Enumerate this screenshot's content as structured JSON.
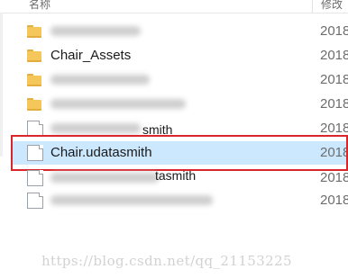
{
  "header": {
    "name_col": "名称",
    "date_col": "修改"
  },
  "rows": [
    {
      "kind": "folder",
      "name": "",
      "date": "2018",
      "blurred": true
    },
    {
      "kind": "folder",
      "name": "Chair_Assets",
      "date": "2018",
      "blurred": false
    },
    {
      "kind": "folder",
      "name": "",
      "date": "2018",
      "blurred": true
    },
    {
      "kind": "folder",
      "name": "",
      "date": "2018",
      "blurred": true
    },
    {
      "kind": "file",
      "name": "smith",
      "date": "2018",
      "blurred": true
    },
    {
      "kind": "file",
      "name": "Chair.udatasmith",
      "date": "2018",
      "blurred": false,
      "selected": true
    },
    {
      "kind": "file",
      "name": "tasmith",
      "date": "2018",
      "blurred": true
    },
    {
      "kind": "file",
      "name": "",
      "date": "2018",
      "blurred": true
    }
  ],
  "watermark": "https://blog.csdn.net/qq_21153225",
  "colors": {
    "selection": "#cce8ff",
    "highlight_border": "#d9262b",
    "folder": "#f5c75a"
  }
}
